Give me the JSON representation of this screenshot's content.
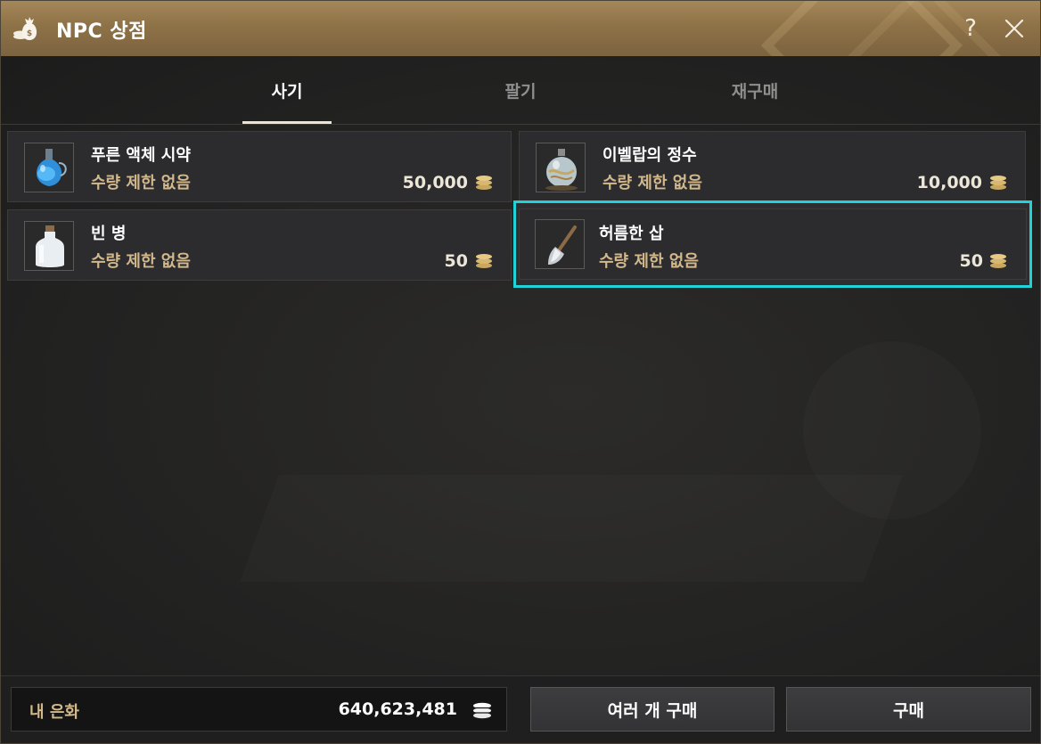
{
  "window": {
    "title": "NPC 상점",
    "icon": "money-bag-icon"
  },
  "tabs": [
    {
      "label": "사기",
      "active": true
    },
    {
      "label": "팔기",
      "active": false
    },
    {
      "label": "재구매",
      "active": false
    }
  ],
  "items": [
    {
      "name": "푸른 액체 시약",
      "limit": "수량 제한 없음",
      "price": "50,000",
      "icon": "blue-potion-flask-icon",
      "selected": false
    },
    {
      "name": "이벨랍의 정수",
      "limit": "수량 제한 없음",
      "price": "10,000",
      "icon": "essence-orb-icon",
      "selected": false
    },
    {
      "name": "빈 병",
      "limit": "수량 제한 없음",
      "price": "50",
      "icon": "empty-bottle-icon",
      "selected": false
    },
    {
      "name": "허름한 삽",
      "limit": "수량 제한 없음",
      "price": "50",
      "icon": "shovel-icon",
      "selected": true
    }
  ],
  "footer": {
    "currency_label": "내 은화",
    "currency_value": "640,623,481",
    "bulk_buy_label": "여러 개 구매",
    "buy_label": "구매"
  },
  "colors": {
    "title_bar": "#8e7247",
    "selection_border": "#1fd3d8",
    "limit_text": "#d2b88b",
    "coin": "#c9a75f"
  }
}
